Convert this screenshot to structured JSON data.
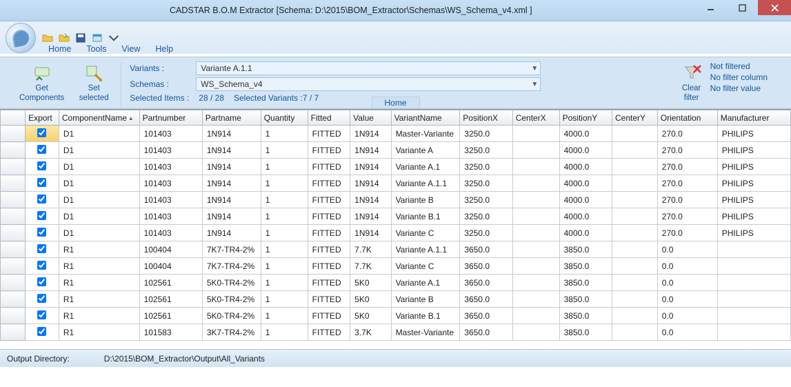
{
  "title": "CADSTAR B.O.M Extractor [Schema:  D:\\2015\\BOM_Extractor\\Schemas\\WS_Schema_v4.xml ]",
  "menu": {
    "home": "Home",
    "tools": "Tools",
    "view": "View",
    "help": "Help"
  },
  "ribbon": {
    "getComponents": "Get\nComponents",
    "setSelected": "Set\nselected",
    "variantsLabel": "Variants :",
    "schemasLabel": "Schemas :",
    "selItemsLabel": "Selected Items :",
    "variantValue": "Variante A.1.1",
    "schemaValue": "WS_Schema_v4",
    "selCount": "28 / 28",
    "selVariantsLabel": "Selected Variants :",
    "selVariants": "7 / 7",
    "clearFilter": "Clear\nfilter",
    "notFiltered": "Not filtered",
    "noFilterCol": "No filter column",
    "noFilterVal": "No filter value",
    "tabLabel": "Home"
  },
  "columns": [
    "Export",
    "ComponentName",
    "Partnumber",
    "Partname",
    "Quantity",
    "Fitted",
    "Value",
    "VariantName",
    "PositionX",
    "CenterX",
    "PositionY",
    "CenterY",
    "Orientation",
    "Manufacturer"
  ],
  "rows": [
    {
      "c": [
        "D1",
        "101403",
        "1N914",
        "1",
        "FITTED",
        "1N914",
        "Master-Variante",
        "3250.0",
        "",
        "4000.0",
        "",
        "270.0",
        "PHILIPS"
      ]
    },
    {
      "c": [
        "D1",
        "101403",
        "1N914",
        "1",
        "FITTED",
        "1N914",
        "Variante A",
        "3250.0",
        "",
        "4000.0",
        "",
        "270.0",
        "PHILIPS"
      ]
    },
    {
      "c": [
        "D1",
        "101403",
        "1N914",
        "1",
        "FITTED",
        "1N914",
        "Variante A.1",
        "3250.0",
        "",
        "4000.0",
        "",
        "270.0",
        "PHILIPS"
      ]
    },
    {
      "c": [
        "D1",
        "101403",
        "1N914",
        "1",
        "FITTED",
        "1N914",
        "Variante A.1.1",
        "3250.0",
        "",
        "4000.0",
        "",
        "270.0",
        "PHILIPS"
      ]
    },
    {
      "c": [
        "D1",
        "101403",
        "1N914",
        "1",
        "FITTED",
        "1N914",
        "Variante B",
        "3250.0",
        "",
        "4000.0",
        "",
        "270.0",
        "PHILIPS"
      ]
    },
    {
      "c": [
        "D1",
        "101403",
        "1N914",
        "1",
        "FITTED",
        "1N914",
        "Variante B.1",
        "3250.0",
        "",
        "4000.0",
        "",
        "270.0",
        "PHILIPS"
      ]
    },
    {
      "c": [
        "D1",
        "101403",
        "1N914",
        "1",
        "FITTED",
        "1N914",
        "Variante C",
        "3250.0",
        "",
        "4000.0",
        "",
        "270.0",
        "PHILIPS"
      ]
    },
    {
      "c": [
        "R1",
        "100404",
        "7K7-TR4-2%",
        "1",
        "FITTED",
        "7.7K",
        "Variante A.1.1",
        "3650.0",
        "",
        "3850.0",
        "",
        "0.0",
        ""
      ]
    },
    {
      "c": [
        "R1",
        "100404",
        "7K7-TR4-2%",
        "1",
        "FITTED",
        "7.7K",
        "Variante C",
        "3650.0",
        "",
        "3850.0",
        "",
        "0.0",
        ""
      ]
    },
    {
      "c": [
        "R1",
        "102561",
        "5K0-TR4-2%",
        "1",
        "FITTED",
        "5K0",
        "Variante A.1",
        "3650.0",
        "",
        "3850.0",
        "",
        "0.0",
        ""
      ]
    },
    {
      "c": [
        "R1",
        "102561",
        "5K0-TR4-2%",
        "1",
        "FITTED",
        "5K0",
        "Variante B",
        "3650.0",
        "",
        "3850.0",
        "",
        "0.0",
        ""
      ]
    },
    {
      "c": [
        "R1",
        "102561",
        "5K0-TR4-2%",
        "1",
        "FITTED",
        "5K0",
        "Variante B.1",
        "3650.0",
        "",
        "3850.0",
        "",
        "0.0",
        ""
      ]
    },
    {
      "c": [
        "R1",
        "101583",
        "3K7-TR4-2%",
        "1",
        "FITTED",
        "3.7K",
        "Master-Variante",
        "3650.0",
        "",
        "3850.0",
        "",
        "0.0",
        ""
      ]
    }
  ],
  "status": {
    "label": "Output Directory:",
    "path": "D:\\2015\\BOM_Extractor\\Output\\All_Variants"
  }
}
